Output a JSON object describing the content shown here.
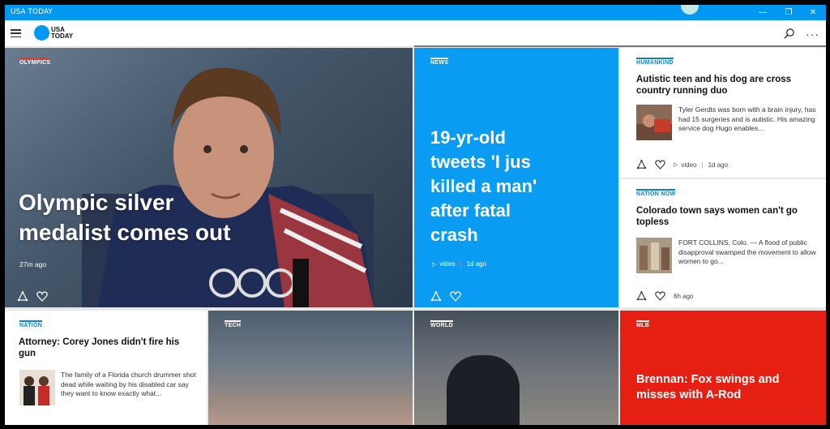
{
  "window": {
    "title": "USA TODAY",
    "controls": [
      "—",
      "❐",
      "✕"
    ]
  },
  "appbar": {
    "logo_line1": "USA",
    "logo_line2": "TODAY",
    "more": "···"
  },
  "colors": {
    "brand_blue": "#0098f0",
    "news_blue": "#0a9bf2",
    "mlb_red": "#e51f12",
    "category_blue": "#0b7fd1"
  },
  "hero": {
    "category": "OLYMPICS",
    "headline_line1": "Olympic silver",
    "headline_line2": "medalist comes out",
    "time": "27m ago"
  },
  "news": {
    "category": "NEWS",
    "headline_line1": "19-yr-old",
    "headline_line2": "tweets 'I jus",
    "headline_line3": "killed a man'",
    "headline_line4": "after fatal",
    "headline_line5": "crash",
    "media": "video",
    "time": "1d ago"
  },
  "humankind": {
    "category": "HUMANKIND",
    "headline": "Autistic teen and his dog are cross country running duo",
    "summary": "Tyler Gerdts was born with a brain injury, has had 15 surgeries and is autistic. His amazing service dog Hugo enables...",
    "media": "video",
    "time": "1d ago"
  },
  "nation_now": {
    "category": "NATION NOW",
    "headline": "Colorado town says women can't go topless",
    "summary": "FORT COLLINS, Colo. — A flood of public disapproval swamped the movement to allow women to go...",
    "time": "6h ago"
  },
  "nation": {
    "category": "NATION",
    "headline": "Attorney: Corey Jones didn't fire his gun",
    "summary": "The family of a Florida church drummer shot dead while waiting by his disabled car say they want to know exactly what..."
  },
  "tech": {
    "category": "TECH"
  },
  "world": {
    "category": "WORLD"
  },
  "mlb": {
    "category": "MLB",
    "headline": "Brennan: Fox swings and misses with A-Rod"
  }
}
